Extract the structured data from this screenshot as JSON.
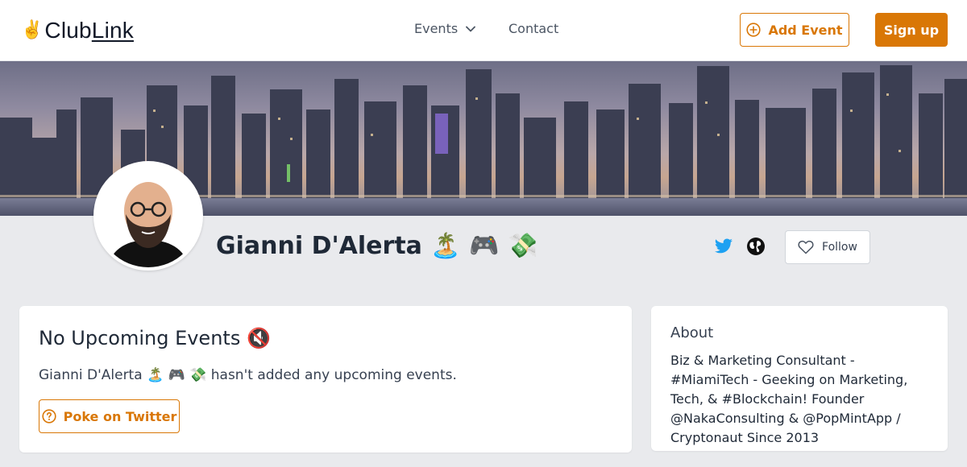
{
  "navbar": {
    "logo_club": "Club",
    "logo_link": "Link",
    "logo_hand_icon": "victory-hand-emoji",
    "events_label": "Events",
    "contact_label": "Contact",
    "add_event_label": "Add Event",
    "signup_label": "Sign up"
  },
  "profile": {
    "name": "Gianni D'Alerta 🏝️ 🎮 💸",
    "follow_label": "Follow",
    "social_icons": [
      "twitter-icon",
      "globe-icon"
    ]
  },
  "events_card": {
    "title": "No Upcoming Events 🔇",
    "message": "Gianni D'Alerta 🏝️ 🎮 💸 hasn't added any upcoming events.",
    "poke_label": "Poke on Twitter"
  },
  "about_card": {
    "title": "About",
    "bio": "Biz & Marketing Consultant - #MiamiTech - Geeking on Marketing, Tech, & #Blockchain! Founder @NakaConsulting & @PopMintApp / Cryptonaut Since 2013"
  },
  "colors": {
    "accent": "#d97706",
    "twitter": "#1da1f2",
    "page_bg": "#e9eaed"
  }
}
